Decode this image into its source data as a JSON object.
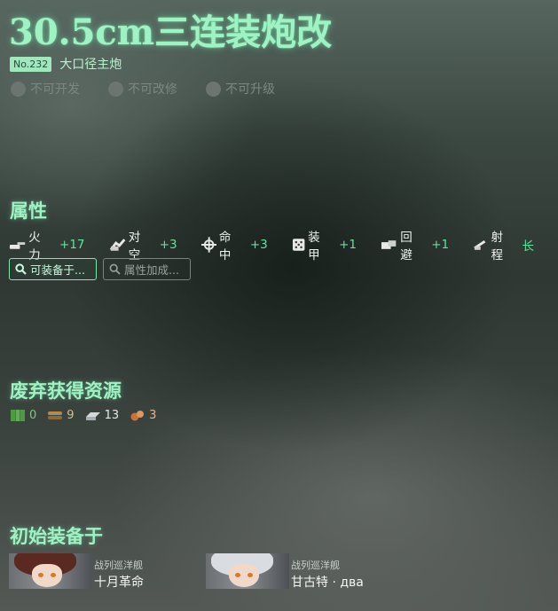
{
  "equipment": {
    "name": "30.5cm三连装炮改",
    "number": "No.232",
    "category": "大口径主炮"
  },
  "flags": [
    {
      "label": "不可开发"
    },
    {
      "label": "不可改修"
    },
    {
      "label": "不可升级"
    }
  ],
  "sections": {
    "stats_title": "属性",
    "scrap_title": "废弃获得资源",
    "initial_title": "初始装备于"
  },
  "stats": [
    {
      "label": "火力",
      "value": "+17",
      "icon": "firepower-icon"
    },
    {
      "label": "对空",
      "value": "+3",
      "icon": "anti-air-icon"
    },
    {
      "label": "命中",
      "value": "+3",
      "icon": "accuracy-icon"
    },
    {
      "label": "装甲",
      "value": "+1",
      "icon": "armor-icon"
    },
    {
      "label": "回避",
      "value": "+1",
      "icon": "evasion-icon"
    },
    {
      "label": "射程",
      "value": "长",
      "icon": "range-icon"
    }
  ],
  "buttons": {
    "equippable": "可装备于...",
    "bonus": "属性加成..."
  },
  "scrap": [
    {
      "resource": "fuel",
      "value": "0",
      "color": "#7fc77a"
    },
    {
      "resource": "ammo",
      "value": "9",
      "color": "#d8bf86"
    },
    {
      "resource": "steel",
      "value": "13",
      "color": "#e6e9ea"
    },
    {
      "resource": "bauxite",
      "value": "3",
      "color": "#e9b48b"
    }
  ],
  "ships": [
    {
      "type": "战列巡洋舰",
      "name": "十月革命",
      "hair": "#5a2a22"
    },
    {
      "type": "战列巡洋舰",
      "name": "甘古特 · два",
      "hair": "#d9dde2"
    }
  ],
  "colors": {
    "accent": "#9ff2c4",
    "positive": "#5fe49a"
  }
}
